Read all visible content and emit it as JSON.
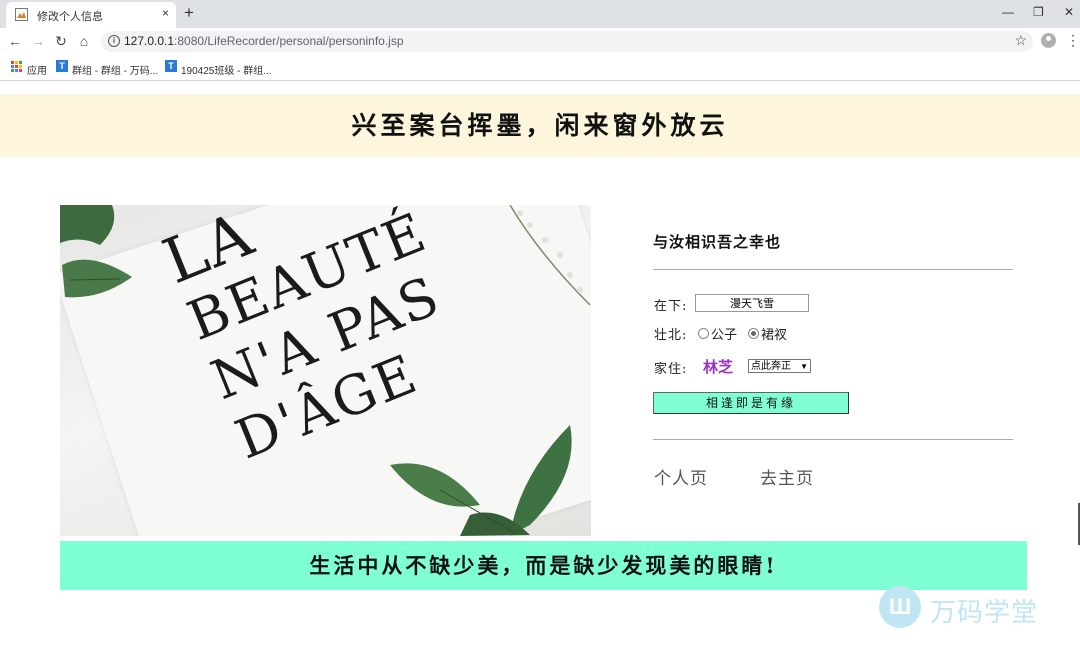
{
  "browser": {
    "tab_title": "修改个人信息",
    "tab_close": "×",
    "new_tab": "+",
    "window_controls": {
      "minimize": "—",
      "restore": "❐",
      "close": "✕"
    },
    "nav": {
      "back": "←",
      "forward": "→",
      "reload": "↻",
      "home": "⌂"
    },
    "url_host": "127.0.0.1",
    "url_rest": ":8080/LifeRecorder/personal/personinfo.jsp",
    "bookmarks": [
      {
        "label": "应用"
      },
      {
        "label": "群组 - 群组 - 万码..."
      },
      {
        "label": "190425班级 - 群组..."
      }
    ]
  },
  "page": {
    "banner_title": "兴至案台挥墨，闲来窗外放云",
    "hero_lines": [
      "LA",
      "BEAUTÉ",
      "N'A PAS",
      "D'ÂGE"
    ],
    "greeting": "与汝相识吾之幸也",
    "name_label": "在下:",
    "name_value": "漫天飞雪",
    "gender_label": "壮北:",
    "gender_options": [
      {
        "label": "公子",
        "checked": false
      },
      {
        "label": "裙衩",
        "checked": true
      }
    ],
    "home_label": "家住:",
    "home_city": "林芝",
    "home_select": "点此奔正",
    "submit_label": "相逢即是有缘",
    "links": {
      "personal": "个人页",
      "main": "去主页"
    },
    "footer_slogan": "生活中从不缺少美，而是缺少发现美的眼睛!",
    "watermark": "万码学堂"
  },
  "colors": {
    "banner_bg": "#fdf6dc",
    "accent_aquamarine": "#7fffd4",
    "city_purple": "#9b2fc7"
  }
}
